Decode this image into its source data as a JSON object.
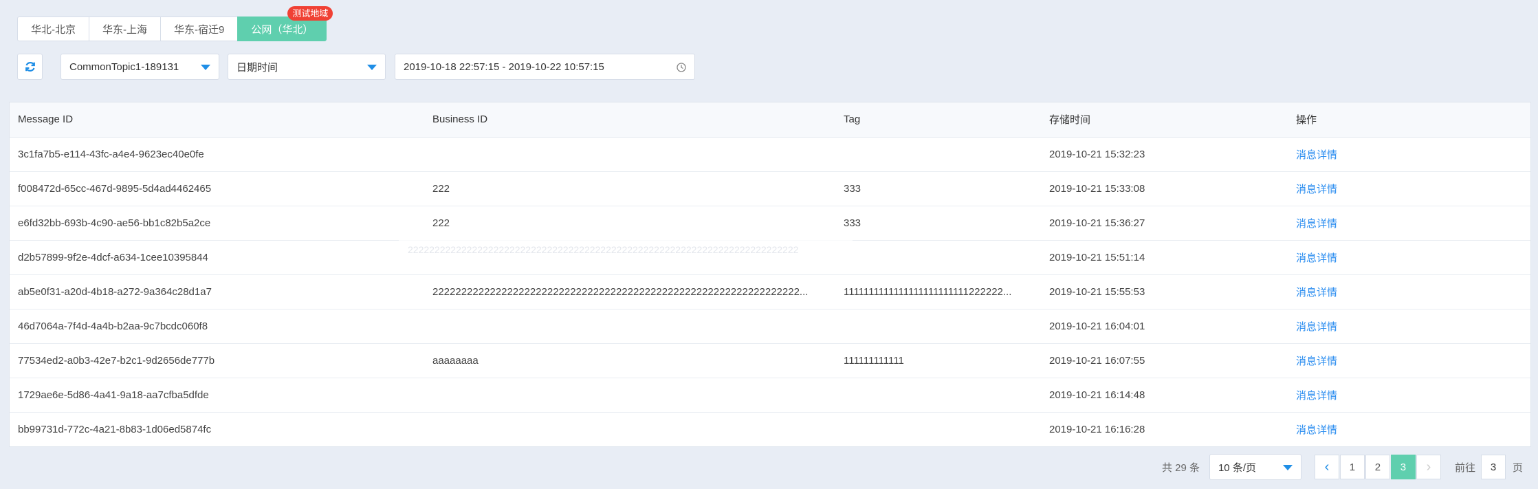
{
  "tabs": [
    {
      "label": "华北-北京"
    },
    {
      "label": "华东-上海"
    },
    {
      "label": "华东-宿迁9"
    },
    {
      "label": "公网（华北）",
      "badge": "测试地域"
    }
  ],
  "filters": {
    "topic": "CommonTopic1-189131",
    "date_type": "日期时间",
    "date_range": "2019-10-18 22:57:15 - 2019-10-22 10:57:15"
  },
  "table": {
    "columns": [
      "Message ID",
      "Business ID",
      "Tag",
      "存储时间",
      "操作"
    ],
    "rows": [
      {
        "id": "3c1fa7b5-e114-43fc-a4e4-9623ec40e0fe",
        "biz": "",
        "tag": "",
        "time": "2019-10-21 15:32:23",
        "action": "消息详情"
      },
      {
        "id": "f008472d-65cc-467d-9895-5d4ad4462465",
        "biz": "222",
        "tag": "333",
        "time": "2019-10-21 15:33:08",
        "action": "消息详情"
      },
      {
        "id": "e6fd32bb-693b-4c90-ae56-bb1c82b5a2ce",
        "biz": "222",
        "tag": "333",
        "time": "2019-10-21 15:36:27",
        "action": "消息详情"
      },
      {
        "id": "d2b57899-9f2e-4dcf-a634-1cee10395844",
        "biz": "",
        "tag": "",
        "time": "2019-10-21 15:51:14",
        "action": "消息详情"
      },
      {
        "id": "ab5e0f31-a20d-4b18-a272-9a364c28d1a7",
        "biz": "2222222222222222222222222222222222222222222222222222222222222222...",
        "tag": "1111111111111111111111111222222...",
        "time": "2019-10-21 15:55:53",
        "action": "消息详情"
      },
      {
        "id": "46d7064a-7f4d-4a4b-b2aa-9c7bcdc060f8",
        "biz": "",
        "tag": "",
        "time": "2019-10-21 16:04:01",
        "action": "消息详情"
      },
      {
        "id": "77534ed2-a0b3-42e7-b2c1-9d2656de777b",
        "biz": "aaaaaaaa",
        "tag": "111111111111",
        "time": "2019-10-21 16:07:55",
        "action": "消息详情"
      },
      {
        "id": "1729ae6e-5d86-4a41-9a18-aa7cfba5dfde",
        "biz": "",
        "tag": "",
        "time": "2019-10-21 16:14:48",
        "action": "消息详情"
      },
      {
        "id": "bb99731d-772c-4a21-8b83-1d06ed5874fc",
        "biz": "",
        "tag": "",
        "time": "2019-10-21 16:16:28",
        "action": "消息详情"
      }
    ]
  },
  "ghost_tooltip": "2222222222222222222222222222222222222222222222222222222222222222222222222",
  "pagination": {
    "total": "共 29 条",
    "page_size": "10 条/页",
    "pages": [
      "1",
      "2",
      "3"
    ],
    "current": "3",
    "goto_label": "前往",
    "goto_value": "3",
    "goto_suffix": "页"
  },
  "colors": {
    "accent": "#5fcfae",
    "link": "#2c8ef0",
    "badge": "#f04134"
  }
}
